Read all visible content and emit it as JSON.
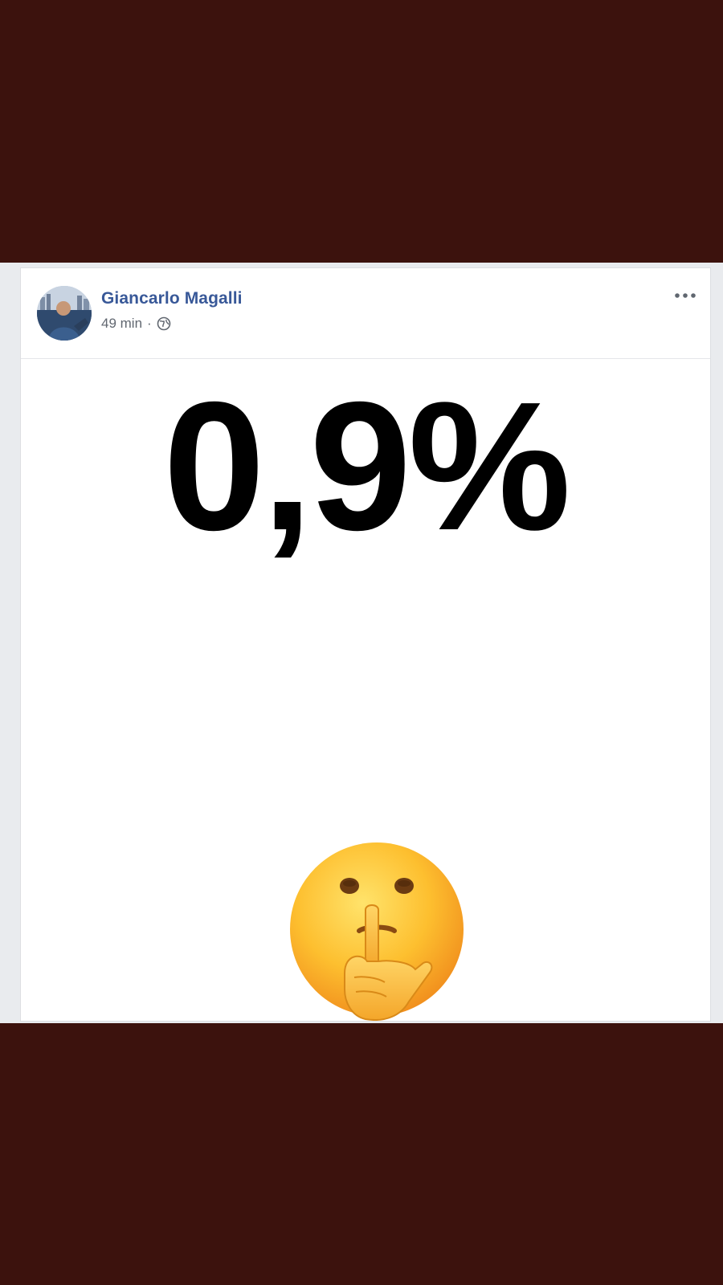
{
  "post": {
    "author": "Giancarlo Magalli",
    "time": "49 min",
    "separator": "·",
    "privacy_icon": "globe-icon",
    "more_icon": "ellipsis-icon"
  },
  "image": {
    "headline": "0,9%",
    "emoji": "shushing-face-emoji"
  },
  "colors": {
    "outer_background": "#3c120d",
    "author_link": "#385898",
    "meta_text": "#616770",
    "feed_background": "#e9ebee"
  }
}
